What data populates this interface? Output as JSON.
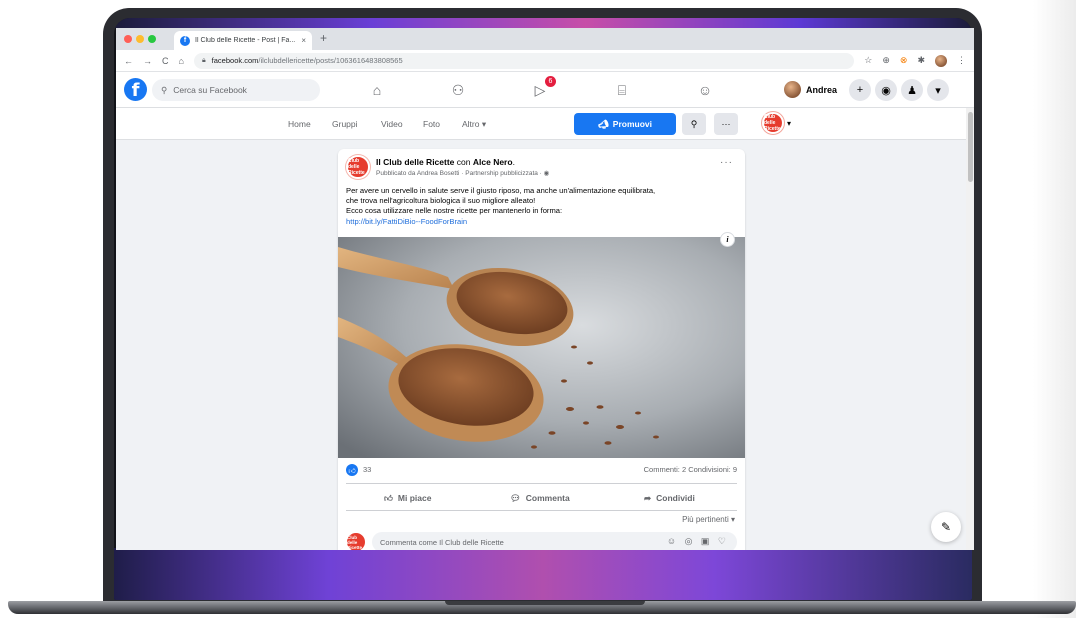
{
  "browser": {
    "tab_title": "Il Club delle Ricette - Post | Fa...",
    "tab_close": "×",
    "new_tab": "+",
    "url_domain": "facebook.com",
    "url_path": "/ilclubdellericette/posts/1063616483808565",
    "nav": {
      "back": "←",
      "forward": "→",
      "reload": "C",
      "home": "⌂"
    },
    "extensions": [
      "☆",
      "⊕",
      "⊗",
      "✱"
    ]
  },
  "facebook": {
    "logo_letter": "f",
    "search_placeholder": "Cerca su Facebook",
    "notif_badge": "6",
    "user_name": "Andrea",
    "icons": [
      "home-icon",
      "friends-icon",
      "watch-icon",
      "marketplace-icon",
      "groups-icon"
    ],
    "colors": {
      "brand": "#1877f2",
      "badge": "#e41e3f"
    }
  },
  "page_nav": {
    "items": [
      "Home",
      "Gruppi",
      "Video",
      "Foto",
      "Altro ▾"
    ],
    "promote": "Promuovi",
    "search_glyph": "⚲",
    "more_glyph": "···",
    "page_logo_text": "Club delle Ricette",
    "page_menu_caret": "▾"
  },
  "post": {
    "author": "Il Club delle Ricette",
    "with_word": "con",
    "partner": "Alce Nero",
    "period": ".",
    "subtitle": "Pubblicato da Andrea Bosetti · Partnership pubblicizzata · ◉",
    "more": "···",
    "text_line1": "Per avere un cervello in salute serve il giusto riposo, ma anche un'alimentazione equilibrata,",
    "text_line2": "che trova nell'agricoltura biologica il suo migliore alleato!",
    "text_line3": "Ecco cosa utilizzare nelle nostre ricette per mantenerlo in forma:",
    "link": "http://bit.ly/FattiDiBio--FoodForBrain",
    "info_glyph": "i",
    "likes": "33",
    "comments_shares": "Commenti: 2  Condivisioni: 9",
    "actions": {
      "like": "Mi piace",
      "comment": "Commenta",
      "share": "Condividi"
    },
    "sort_label": "Più pertinenti ▾",
    "comment_placeholder": "Commenta come Il Club delle Ricette",
    "comment_icons": "☺ ◎ ▣ ♡"
  }
}
